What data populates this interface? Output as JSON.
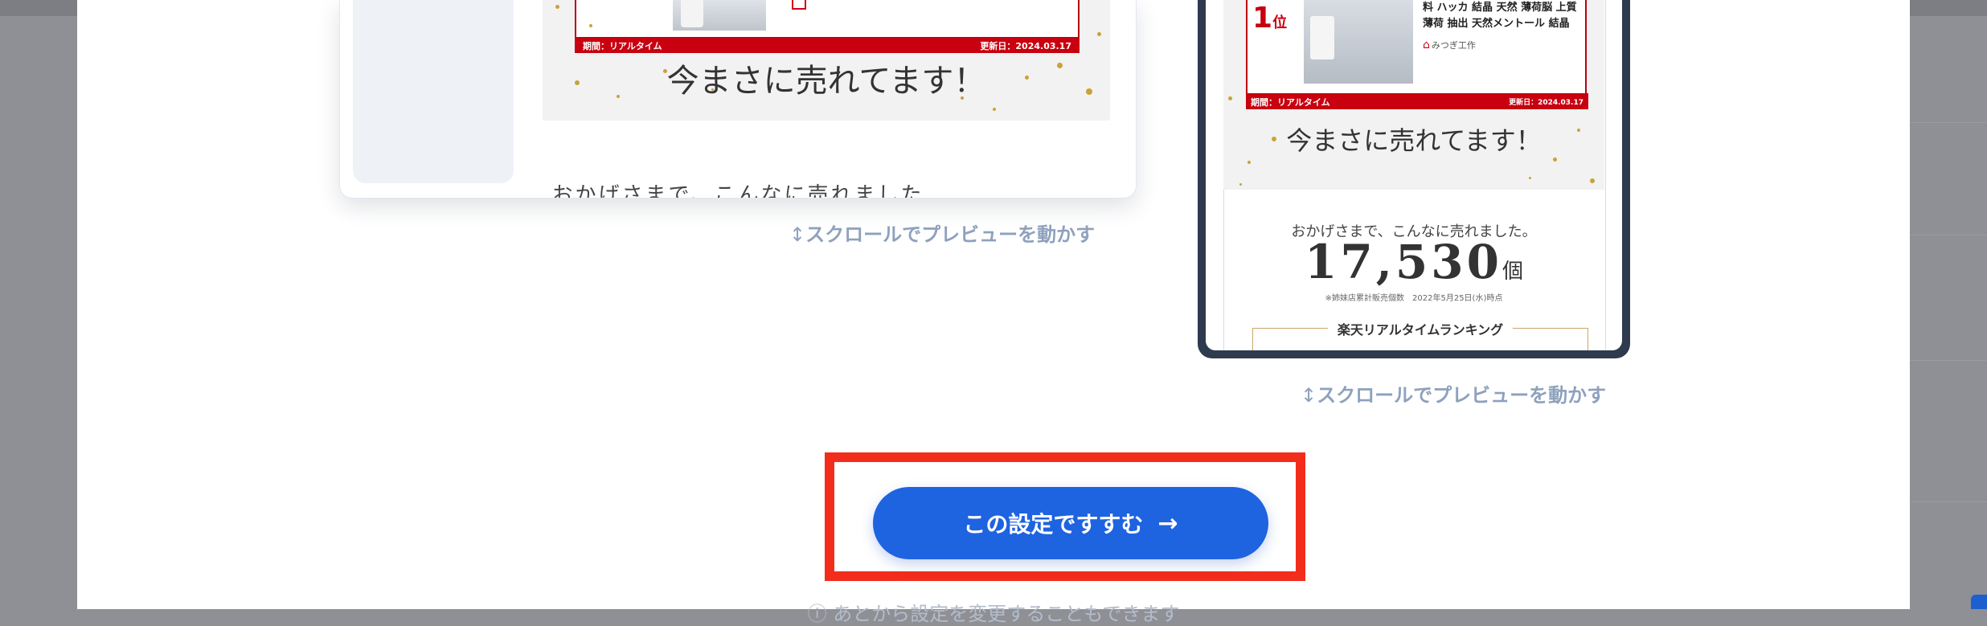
{
  "desktop_preview": {
    "rank_period": "期間：リアルタイム",
    "rank_updated": "更新日：2024.03.17",
    "selling_now": "今まさに売れてます！",
    "sold_message": "おかげさまで、こんなに売れました",
    "scroll_hint": "スクロールでプレビューを動かす"
  },
  "mobile_preview": {
    "rank_number": "1",
    "rank_unit": "位",
    "product_desc": "料 ハッカ 結晶 天然 薄荷脳 上質 薄荷 抽出 天然メントール 結晶 L…",
    "shop_name": "みつぎ工作",
    "rank_period": "期間：リアルタイム",
    "rank_updated": "更新日：2024.03.17",
    "selling_now": "今まさに売れてます！",
    "sold_message": "おかげさまで、こんなに売れました。",
    "sold_count": "17,530",
    "sold_unit": "個",
    "sold_note": "※姉妹店累計販売個数　2022年5月25日(水)時点",
    "realtime_ranking": "楽天リアルタイムランキング",
    "scroll_hint": "スクロールでプレビューを動かす"
  },
  "cta": {
    "label": "この設定ですすむ",
    "arrow": "→"
  },
  "footer_note": "ⓘ あとから設定を変更することもできます",
  "colors": {
    "primary": "#1e63e0",
    "highlight": "#f32d1c",
    "rank_red": "#c8000f",
    "hint": "#8ea1bd"
  }
}
